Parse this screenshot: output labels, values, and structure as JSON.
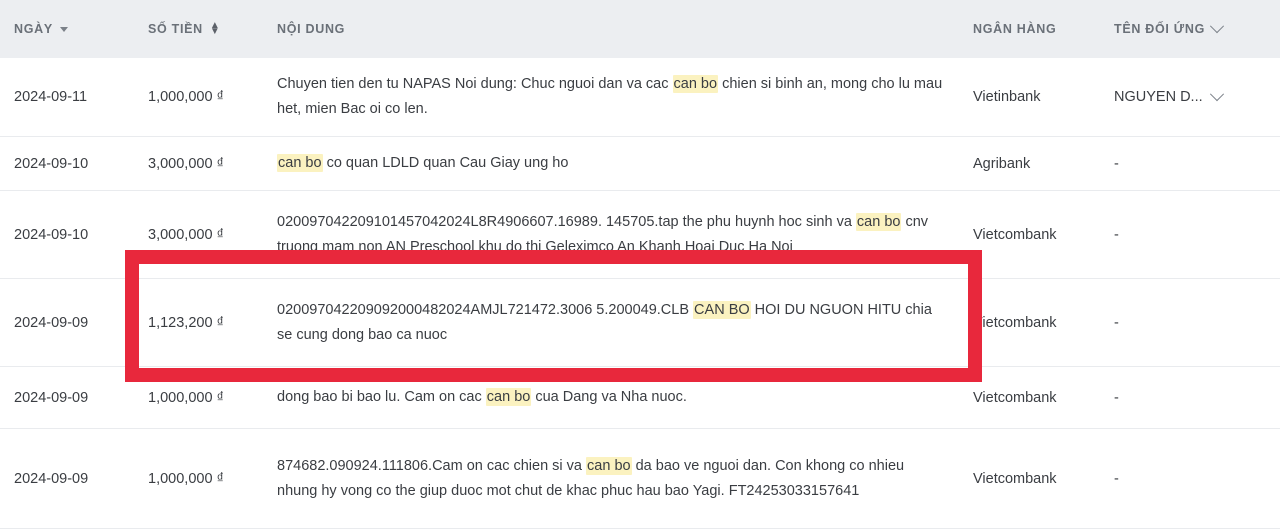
{
  "table": {
    "columns": [
      {
        "key": "date",
        "label": "NGÀY",
        "icon": "caret-down-icon",
        "sortable": true
      },
      {
        "key": "amount",
        "label": "SỐ TIỀN",
        "icon": "sort-updown-icon",
        "sortable": true
      },
      {
        "key": "content",
        "label": "NỘI DUNG",
        "icon": "",
        "sortable": false
      },
      {
        "key": "bank",
        "label": "NGÂN HÀNG",
        "icon": "",
        "sortable": false
      },
      {
        "key": "name",
        "label": "TÊN ĐỐI ỨNG",
        "icon": "chevron-down-icon",
        "sortable": true
      }
    ],
    "rows": [
      {
        "date": "2024-09-11",
        "amount": "1,000,000 ₫",
        "content_parts": [
          {
            "text": "Chuyen tien den tu NAPAS Noi dung: Chuc nguoi dan va cac ",
            "highlight": false
          },
          {
            "text": "can bo",
            "highlight": true
          },
          {
            "text": " chien si binh an, mong cho lu mau het, mien Bac oi co len.",
            "highlight": false
          }
        ],
        "bank": "Vietinbank",
        "name": "NGUYEN D...",
        "name_icon": "chevron-down-icon"
      },
      {
        "date": "2024-09-10",
        "amount": "3,000,000 ₫",
        "content_parts": [
          {
            "text": "can bo",
            "highlight": true
          },
          {
            "text": " co quan LDLD quan Cau Giay ung ho",
            "highlight": false
          }
        ],
        "bank": "Agribank",
        "name": "-",
        "name_icon": ""
      },
      {
        "date": "2024-09-10",
        "amount": "3,000,000 ₫",
        "content_parts": [
          {
            "text": "020097042209101457042024L8R4906607.16989. 145705.tap the phu huynh hoc sinh va ",
            "highlight": false
          },
          {
            "text": "can bo",
            "highlight": true
          },
          {
            "text": " cnv truong mam non AN Preschool khu do thi Geleximco An Khanh Hoai Duc Ha Noi",
            "highlight": false
          }
        ],
        "bank": "Vietcombank",
        "name": "-",
        "name_icon": ""
      },
      {
        "date": "2024-09-09",
        "amount": "1,123,200 ₫",
        "content_parts": [
          {
            "text": "020097042209092000482024AMJL721472.3006 5.200049.CLB ",
            "highlight": false
          },
          {
            "text": "CAN BO",
            "highlight": true
          },
          {
            "text": " HOI DU NGUON HITU chia se cung dong bao ca nuoc",
            "highlight": false
          }
        ],
        "bank": "Vietcombank",
        "name": "-",
        "name_icon": ""
      },
      {
        "date": "2024-09-09",
        "amount": "1,000,000 ₫",
        "content_parts": [
          {
            "text": "dong bao bi bao lu. Cam on cac ",
            "highlight": false
          },
          {
            "text": "can bo",
            "highlight": true
          },
          {
            "text": " cua Dang va Nha nuoc.",
            "highlight": false
          }
        ],
        "bank": "Vietcombank",
        "name": "-",
        "name_icon": ""
      },
      {
        "date": "2024-09-09",
        "amount": "1,000,000 ₫",
        "content_parts": [
          {
            "text": "874682.090924.111806.Cam on cac chien si va ",
            "highlight": false
          },
          {
            "text": "can bo",
            "highlight": true
          },
          {
            "text": " da bao ve nguoi dan. Con khong co nhieu nhung hy vong co the giup duoc mot chut de khac phuc hau bao Yagi. FT24253033157641",
            "highlight": false
          }
        ],
        "bank": "Vietcombank",
        "name": "-",
        "name_icon": ""
      }
    ]
  },
  "annotation": {
    "type": "red-rectangle-highlight",
    "color": "#e8283c",
    "targets_row_index": 3
  },
  "colors": {
    "header_background": "#eceef1",
    "header_text": "#6a7078",
    "row_border": "#e9ebee",
    "highlight_yellow": "#fbf2c0",
    "annotation_red": "#e8283c",
    "body_text": "#3a3d42"
  }
}
